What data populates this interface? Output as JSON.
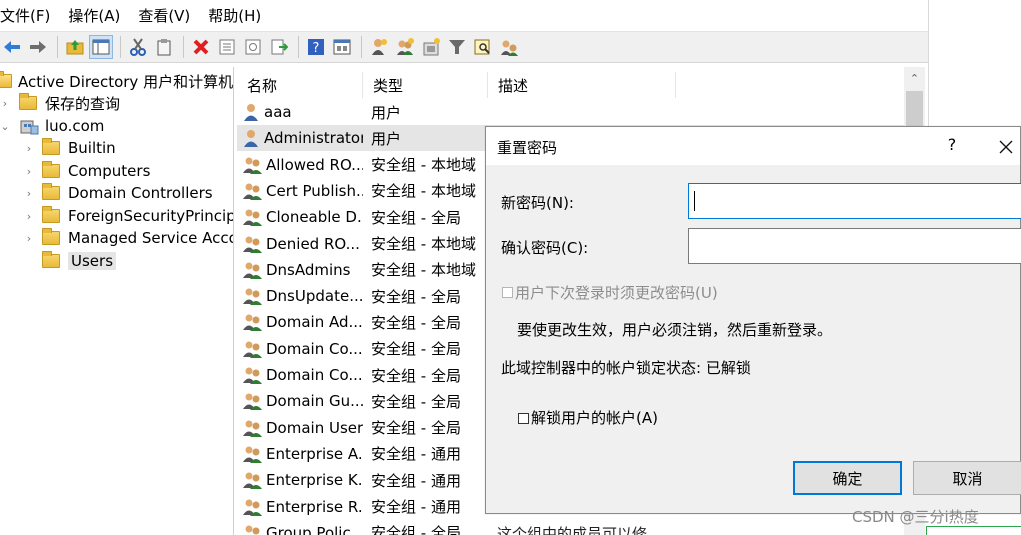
{
  "menubar": {
    "items": [
      "文件(F)",
      "操作(A)",
      "查看(V)",
      "帮助(H)"
    ]
  },
  "toolbar": {
    "icons": [
      "back-icon",
      "forward-icon",
      "up-folder-icon",
      "show-hide-tree-icon",
      "cut-icon",
      "copy-icon",
      "delete-icon",
      "properties-icon",
      "refresh-icon",
      "export-icon",
      "help-icon",
      "view-icon",
      "new-user-icon",
      "new-group-icon",
      "new-ou-icon",
      "filter-icon",
      "find-icon",
      "add-to-group-icon"
    ]
  },
  "tree": {
    "root": "Active Directory 用户和计算机 [",
    "saved_queries": "保存的查询",
    "domain": "luo.com",
    "children": [
      "Builtin",
      "Computers",
      "Domain Controllers",
      "ForeignSecurityPrincipal",
      "Managed Service Accou",
      "Users"
    ],
    "selected": "Users"
  },
  "list": {
    "headers": {
      "name": "名称",
      "type": "类型",
      "desc": "描述"
    },
    "rows": [
      {
        "name": "aaa",
        "type": "用户",
        "desc": "",
        "icon": "user-icon"
      },
      {
        "name": "Administrator",
        "type": "用户",
        "desc": "",
        "icon": "user-icon"
      },
      {
        "name": "Allowed RO...",
        "type": "安全组 - 本地域",
        "desc": "",
        "icon": "group-icon"
      },
      {
        "name": "Cert Publish...",
        "type": "安全组 - 本地域",
        "desc": "",
        "icon": "group-icon"
      },
      {
        "name": "Cloneable D...",
        "type": "安全组 - 全局",
        "desc": "",
        "icon": "group-icon"
      },
      {
        "name": "Denied RO...",
        "type": "安全组 - 本地域",
        "desc": "",
        "icon": "group-icon"
      },
      {
        "name": "DnsAdmins",
        "type": "安全组 - 本地域",
        "desc": "",
        "icon": "group-icon"
      },
      {
        "name": "DnsUpdate...",
        "type": "安全组 - 全局",
        "desc": "",
        "icon": "group-icon"
      },
      {
        "name": "Domain Ad...",
        "type": "安全组 - 全局",
        "desc": "",
        "icon": "group-icon"
      },
      {
        "name": "Domain Co...",
        "type": "安全组 - 全局",
        "desc": "",
        "icon": "group-icon"
      },
      {
        "name": "Domain Co...",
        "type": "安全组 - 全局",
        "desc": "",
        "icon": "group-icon"
      },
      {
        "name": "Domain Gu...",
        "type": "安全组 - 全局",
        "desc": "",
        "icon": "group-icon"
      },
      {
        "name": "Domain Users",
        "type": "安全组 - 全局",
        "desc": "",
        "icon": "group-icon"
      },
      {
        "name": "Enterprise A...",
        "type": "安全组 - 通用",
        "desc": "",
        "icon": "group-icon"
      },
      {
        "name": "Enterprise K...",
        "type": "安全组 - 通用",
        "desc": "",
        "icon": "group-icon"
      },
      {
        "name": "Enterprise R...",
        "type": "安全组 - 通用",
        "desc": "",
        "icon": "group-icon"
      },
      {
        "name": "Group Polic...",
        "type": "安全组 - 全局",
        "desc": "这个组中的成员可以修",
        "icon": "group-icon"
      }
    ],
    "selected_index": 1
  },
  "dialog": {
    "title": "重置密码",
    "help": "?",
    "new_password_label": "新密码(N):",
    "new_password_value": "",
    "confirm_password_label": "确认密码(C):",
    "confirm_password_value": "",
    "must_change_label": "用户下次登录时须更改密码(U)",
    "info_text": "要使更改生效，用户必须注销，然后重新登录。",
    "lockout_status": "此域控制器中的帐户锁定状态: 已解锁",
    "unlock_label": "解锁用户的帐户(A)",
    "ok": "确定",
    "cancel": "取消"
  },
  "watermark": "CSDN @三分i热度",
  "colors": {
    "accent": "#0078d7",
    "selection": "#e5e5e5",
    "dialog_bg": "#f0f0f0"
  }
}
